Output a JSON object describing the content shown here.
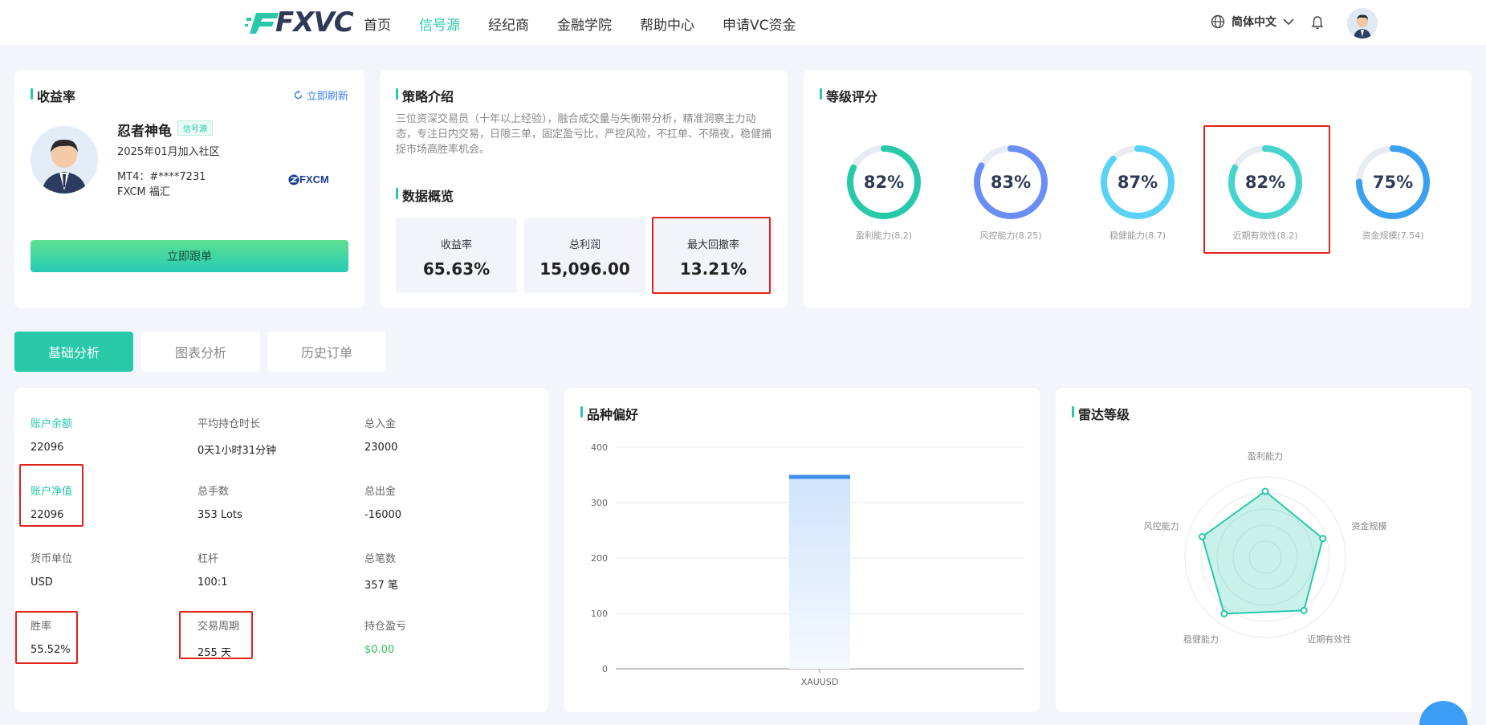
{
  "nav": {
    "logo": "FXVC",
    "items": [
      "首页",
      "信号源",
      "经纪商",
      "金融学院",
      "帮助中心",
      "申请VC资金"
    ],
    "active_index": 1,
    "language": "简体中文"
  },
  "profile": {
    "section_title": "收益率",
    "refresh_label": "立即刷新",
    "name": "忍者神龟",
    "badge": "信号源",
    "joined": "2025年01月加入社区",
    "account": "MT4：#****7231",
    "broker": "FXCM 福汇",
    "broker_logo": "FXCM",
    "follow_button": "立即跟单"
  },
  "strategy": {
    "title": "策略介绍",
    "description": "三位资深交易员（十年以上经验），融合成交量与失衡带分析，精准洞察主力动态，专注日内交易，日限三单，固定盈亏比，严控风险，不扛单、不隔夜，稳健捕捉市场高胜率机会。",
    "overview_title": "数据概览",
    "stats": [
      {
        "label": "收益率",
        "value": "65.63%"
      },
      {
        "label": "总利润",
        "value": "15,096.00"
      },
      {
        "label": "最大回撤率",
        "value": "13.21%"
      }
    ]
  },
  "rating": {
    "title": "等级评分",
    "items": [
      {
        "pct": "82%",
        "label": "盈利能力(8.2)",
        "fraction": 0.82,
        "color": "#27c9a9"
      },
      {
        "pct": "83%",
        "label": "风控能力(8.25)",
        "fraction": 0.83,
        "color": "#6b8ef5"
      },
      {
        "pct": "87%",
        "label": "稳健能力(8.7)",
        "fraction": 0.87,
        "color": "#5ad2f5"
      },
      {
        "pct": "82%",
        "label": "近期有效性(8.2)",
        "fraction": 0.82,
        "color": "#47d4cf"
      },
      {
        "pct": "75%",
        "label": "资金规模(7.54)",
        "fraction": 0.75,
        "color": "#3aa0f0"
      }
    ]
  },
  "tabs": [
    "基础分析",
    "图表分析",
    "历史订单"
  ],
  "account_info": {
    "cells": [
      {
        "label": "账户余额",
        "value": "22096",
        "green_label": true
      },
      {
        "label": "平均持仓时长",
        "value": "0天1小时31分钟"
      },
      {
        "label": "总入金",
        "value": "23000"
      },
      {
        "label": "账户净值",
        "value": "22096",
        "green_label": true
      },
      {
        "label": "总手数",
        "value": "353 Lots"
      },
      {
        "label": "总出金",
        "value": "-16000"
      },
      {
        "label": "货币单位",
        "value": "USD"
      },
      {
        "label": "杠杆",
        "value": "100:1"
      },
      {
        "label": "总笔数",
        "value": "357 笔"
      },
      {
        "label": "胜率",
        "value": "55.52%"
      },
      {
        "label": "交易周期",
        "value": "255 天"
      },
      {
        "label": "持仓盈亏",
        "value": "$0.00",
        "green_value": true
      }
    ]
  },
  "variety": {
    "title": "品种偏好"
  },
  "radar": {
    "title": "雷达等级",
    "labels": [
      "盈利能力",
      "资金规模",
      "近期有效性",
      "稳健能力",
      "风控能力"
    ]
  },
  "chart_data": [
    {
      "type": "bar",
      "title": "品种偏好",
      "categories": [
        "XAUUSD"
      ],
      "values": [
        350
      ],
      "ylim": [
        0,
        400
      ],
      "yticks": [
        0,
        100,
        200,
        300,
        400
      ],
      "grid": true
    },
    {
      "type": "radar",
      "title": "雷达等级",
      "axes": [
        "盈利能力",
        "资金规模",
        "近期有效性",
        "稳健能力",
        "风控能力"
      ],
      "values": [
        8.2,
        7.54,
        8.2,
        8.7,
        8.25
      ],
      "range": [
        0,
        10
      ]
    }
  ]
}
